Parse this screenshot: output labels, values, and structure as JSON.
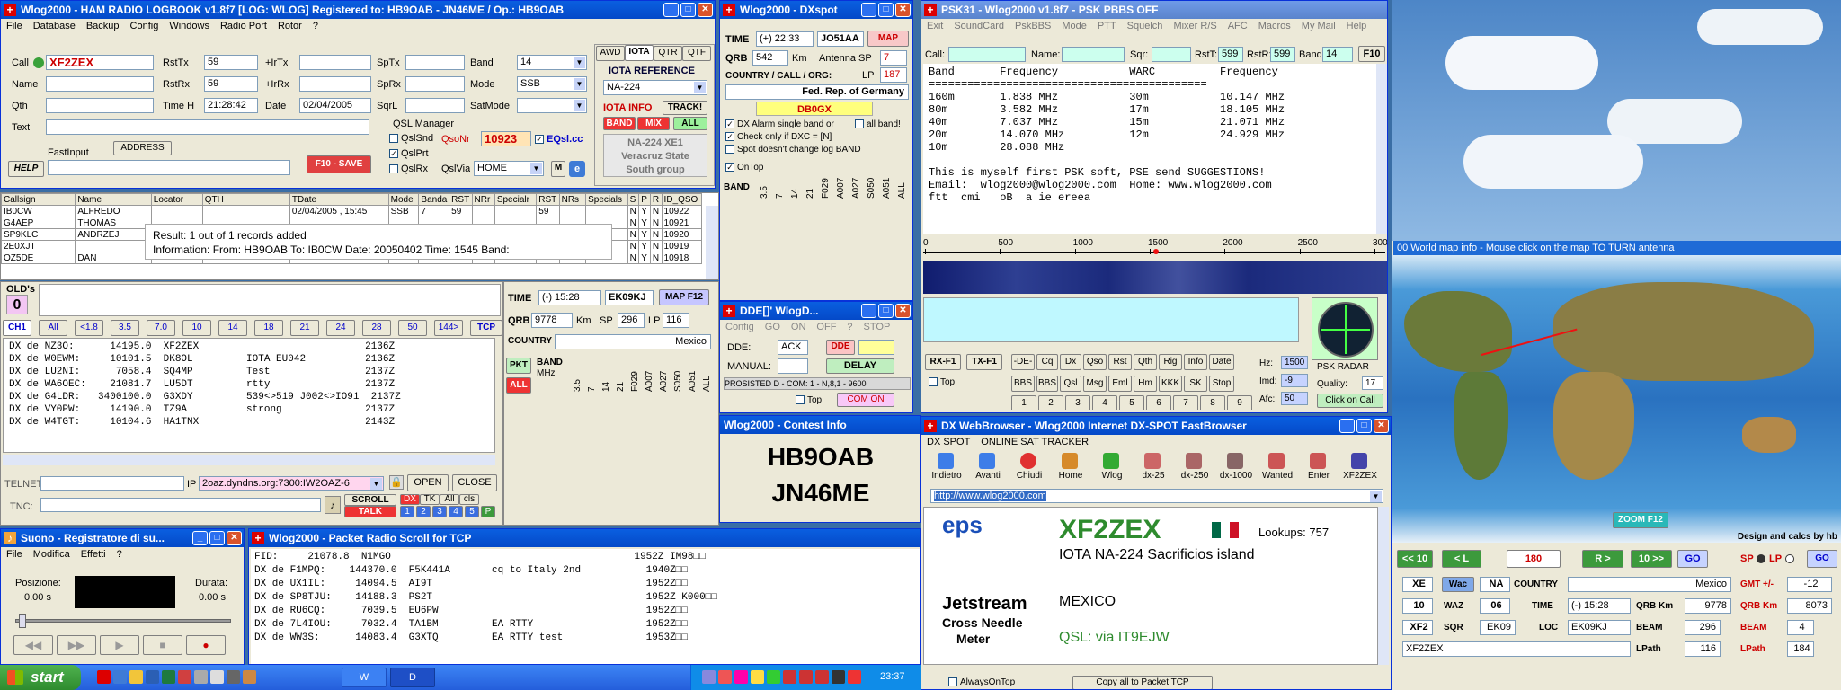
{
  "logbook": {
    "title": "Wlog2000 - HAM RADIO LOGBOOK v1.8f7      [LOG: WLOG]   Registered to: HB9OAB - JN46ME / Op.: HB9OAB",
    "menu": [
      "File",
      "Database",
      "Backup",
      "Config",
      "Windows",
      "Radio Port",
      "Rotor",
      "?"
    ],
    "labels": {
      "call": "Call",
      "name": "Name",
      "qth": "Qth",
      "text": "Text",
      "help": "HELP",
      "rsttx": "RstTx",
      "rstrx": "RstRx",
      "timeh": "Time H",
      "irtx": "+IrTx",
      "irrx": "+IrRx",
      "date": "Date",
      "sptx": "SpTx",
      "sprx": "SpRx",
      "sqrl": "SqrL",
      "band": "Band",
      "mode": "Mode",
      "satmode": "SatMode",
      "fastinput": "FastInput",
      "address": "ADDRESS",
      "qslmanager": "QSL Manager",
      "qslsnd": "QslSnd",
      "qslprt": "QslPrt",
      "qslrx": "QslRx",
      "qsonr": "QsoNr",
      "eqsl": "EQsl.cc",
      "qslvia": "QslVia",
      "save": "F10 - SAVE",
      "m": "M"
    },
    "values": {
      "call": "XF2ZEX",
      "rsttx": "59",
      "rstrx": "59",
      "timeh": "21:28:42",
      "date": "02/04/2005",
      "band": "14",
      "mode": "SSB",
      "qsonr": "10923",
      "qslvia": "HOME"
    },
    "tabs": [
      "AWD",
      "IOTA",
      "QTR",
      "QTF"
    ],
    "iota": {
      "reference_label": "IOTA REFERENCE",
      "ref": "NA-224",
      "info": "IOTA INFO",
      "track": "TRACK!",
      "band": "BAND",
      "mix": "MIX",
      "all": "ALL",
      "desc": [
        "NA-224 XE1",
        "Veracruz State",
        "South group"
      ]
    }
  },
  "qsogrid": {
    "headers": [
      "Callsign",
      "Name",
      "Locator",
      "QTH",
      "TDate",
      "Mode",
      "Banda",
      "RST",
      "NRr",
      "Specialr",
      "RST",
      "NRs",
      "Specials",
      "S",
      "P",
      "R",
      "ID_QSO"
    ],
    "rows": [
      [
        "IB0CW",
        "ALFREDO",
        "",
        "",
        "02/04/2005 , 15:45",
        "SSB",
        "7",
        "59",
        "",
        "",
        "59",
        "",
        "",
        "N",
        "Y",
        "N",
        "10922"
      ],
      [
        "G4AEP",
        "THOMAS",
        "",
        "",
        "",
        "",
        "",
        "",
        "",
        "",
        "",
        "",
        "",
        "N",
        "Y",
        "N",
        "10921"
      ],
      [
        "SP9KLC",
        "ANDRZEJ",
        "",
        "",
        "",
        "",
        "",
        "",
        "",
        "",
        "",
        "",
        "",
        "N",
        "Y",
        "N",
        "10920"
      ],
      [
        "2E0XJT",
        "",
        "",
        "",
        "",
        "",
        "",
        "",
        "",
        "",
        "",
        "",
        "",
        "N",
        "Y",
        "N",
        "10919"
      ],
      [
        "OZ5DE",
        "DAN",
        "",
        "",
        "",
        "",
        "",
        "",
        "",
        "",
        "",
        "",
        "",
        "N",
        "Y",
        "N",
        "10918"
      ]
    ],
    "popup": [
      "Result: 1 out of 1 records added",
      "Information: From: HB9OAB To: IB0CW Date: 20050402 Time: 1545 Band:"
    ]
  },
  "cluster": {
    "olds": "OLD's",
    "olds_count": "0",
    "bands": [
      "CH1",
      "All",
      "<1.8",
      "3.5",
      "7.0",
      "10",
      "14",
      "18",
      "21",
      "24",
      "28",
      "50",
      "144>",
      "TCP"
    ],
    "lines": [
      "DX de NZ3O:      14195.0  XF2ZEX                            2136Z",
      "DX de W0EWM:     10101.5  DK8OL         IOTA EU042          2136Z",
      "DX de LU2NI:      7058.4  SQ4MP         Test                2137Z",
      "DX de WA6OEC:    21081.7  LU5DT         rtty                2137Z",
      "DX de G4LDR:   3400100.0  G3XDY         539<>519 J002<>IO91  2137Z",
      "DX de VY0PW:     14190.0  TZ9A          strong              2137Z",
      "DX de W4TGT:     10104.6  HA1TNX                            2143Z"
    ],
    "telnet": "TELNET:",
    "ip_label": "IP",
    "ip": "2oaz.dyndns.org:7300:IW2OAZ-6",
    "open": "OPEN",
    "close": "CLOSE",
    "tnc": "TNC:",
    "scroll": "SCROLL",
    "talk": "TALK",
    "dx": "DX",
    "tk": "TK",
    "all": "All",
    "cls": "cls",
    "nums": [
      "1",
      "2",
      "3",
      "4",
      "5",
      "P"
    ]
  },
  "info2": {
    "time_label": "TIME",
    "time": "(-) 15:28",
    "loc": "EK09KJ",
    "map": "MAP F12",
    "qrb_label": "QRB",
    "qrb": "9778",
    "km": "Km",
    "sp_label": "SP",
    "sp": "296",
    "lp_label": "LP",
    "lp": "116",
    "country_label": "COUNTRY",
    "country": "Mexico",
    "pkt": "PKT",
    "all": "ALL",
    "band": "BAND",
    "mhz": "MHz",
    "cols": [
      "3.5",
      "7",
      "14",
      "21",
      "F029",
      "A007",
      "A027",
      "S050",
      "A051",
      "ALL"
    ],
    "rows": [
      [
        "DXC",
        "XE"
      ],
      [
        "WPX",
        "XF2"
      ],
      [
        "WAZ",
        "06"
      ],
      [
        "ITU",
        "10"
      ],
      [
        "WAC",
        "NA"
      ],
      [
        "SQR",
        ""
      ]
    ]
  },
  "dxspot": {
    "title": "Wlog2000 - DXspot",
    "time_label": "TIME",
    "time": "(+) 22:33",
    "loc": "JO51AA",
    "map": "MAP",
    "qrb_label": "QRB",
    "qrb": "542",
    "km": "Km",
    "antenna": "Antenna SP",
    "sp": "7",
    "country_label": "COUNTRY / CALL / ORG:",
    "lp_label": "LP",
    "lp": "187",
    "country": "Fed. Rep. of Germany",
    "call": "DB0GX",
    "opts": [
      "DX Alarm single band or",
      "all band!",
      "Check only if DXC = [N]",
      "Spot doesn't change log BAND",
      "OnTop"
    ],
    "band": "BAND",
    "cols": [
      "3.5",
      "7",
      "14",
      "21",
      "F029",
      "A007",
      "A027",
      "S050",
      "A051",
      "ALL"
    ],
    "rows": [
      [
        "DXC",
        "OL"
      ],
      [
        "WPX",
        "DB0"
      ],
      [
        "WAZ",
        "14"
      ],
      [
        "ITU",
        "28"
      ],
      [
        "WAC",
        "EU"
      ]
    ]
  },
  "dde": {
    "title": "DDE[]' WlogD...",
    "menu": [
      "Config",
      "GO",
      "ON",
      "OFF",
      "?",
      "STOP"
    ],
    "dde_label": "DDE:",
    "ack": "ACK",
    "dde": "DDE",
    "manual": "MANUAL:",
    "delay": "DELAY",
    "status": "PROSISTED D - COM: 1 - N,8,1 - 9600",
    "top": "Top",
    "com": "COM ON"
  },
  "contest": {
    "title": "Wlog2000 - Contest Info",
    "call": "HB9OAB",
    "loc": "JN46ME"
  },
  "psk": {
    "title": "PSK31 - Wlog2000 v1.8f7 - PSK PBBS OFF",
    "menu": [
      "Exit",
      "SoundCard",
      "PskBBS",
      "Mode",
      "PTT",
      "Squelch",
      "Mixer R/S",
      "AFC",
      "Macros",
      "My Mail",
      "Help"
    ],
    "fields": {
      "call": "Call:",
      "name": "Name:",
      "sqr": "Sqr:",
      "rstt": "RstT:",
      "rstt_v": "599",
      "rstr": "RstR:",
      "rstr_v": "599",
      "band": "Band:",
      "band_v": "14",
      "f10": "F10"
    },
    "text": [
      "Band       Frequency           WARC          Frequency",
      "===========================================",
      "160m       1.838 MHz           30m           10.147 MHz",
      "80m        3.582 MHz           17m           18.105 MHz",
      "40m        7.037 MHz           15m           21.071 MHz",
      "20m        14.070 MHz          12m           24.929 MHz",
      "10m        28.088 MHz",
      "",
      "This is myself first PSK soft, PSE send SUGGESTIONS!",
      "Email:  wlog2000@wlog2000.com  Home: www.wlog2000.com",
      "ftt  cmi   oB  a ie ereea"
    ],
    "scale": [
      "0",
      "500",
      "1000",
      "1500",
      "2000",
      "2500",
      "3000"
    ],
    "buttons": [
      "RX-F1",
      "TX-F1",
      "-DE-",
      "Cq",
      "Dx",
      "Qso",
      "Rst",
      "Qth",
      "Rig",
      "Info",
      "Date",
      "BBS",
      "BBS",
      "Qsl",
      "Msg",
      "Eml",
      "Hm",
      "KKK",
      "SK",
      "Stop",
      "1",
      "2",
      "3",
      "4",
      "5",
      "6",
      "7",
      "8",
      "9"
    ],
    "top": "Top",
    "hz": "Hz:",
    "hz_v": "1500",
    "imd": "Imd:",
    "imd_v": "-9",
    "afc": "Afc:",
    "afc_v": "50",
    "radar": "PSK RADAR",
    "quality": "Quality:",
    "quality_v": "17",
    "click": "Click on Call"
  },
  "web": {
    "title": "DX WebBrowser - Wlog2000 Internet DX-SPOT FastBrowser",
    "menu": [
      "DX SPOT",
      "ONLINE SAT TRACKER"
    ],
    "tools": [
      "Indietro",
      "Avanti",
      "Chiudi",
      "Home",
      "Wlog",
      "dx-25",
      "dx-250",
      "dx-1000",
      "Wanted",
      "Enter",
      "XF2ZEX"
    ],
    "url": "http://www.wlog2000.com",
    "logo": "eps",
    "call": "XF2ZEX",
    "lookups": "Lookups: 757",
    "iota": "IOTA NA-224 Sacrificios island",
    "country": "MEXICO",
    "qsl": "QSL:  via IT9EJW",
    "ad1": "Jetstream",
    "ad2": "Cross Needle",
    "ad3": "Meter",
    "ontop": "AlwaysOnTop",
    "copy": "Copy all to Packet TCP"
  },
  "worldmap": {
    "title": "00 World map info - Mouse click on the map TO TURN antenna",
    "zoom": "ZOOM F12",
    "design": "Design and calcs by hb",
    "nav": [
      "<< 10",
      "< L",
      "180",
      "R >",
      "10 >>",
      "GO"
    ],
    "sp": "SP",
    "lp": "LP",
    "go": "GO",
    "row1": [
      "XE",
      "Wac",
      "NA",
      "COUNTRY",
      "Mexico",
      "GMT +/-",
      "-12"
    ],
    "f11": "F11",
    "row2": [
      "10",
      "WAZ",
      "06",
      "TIME",
      "(-) 15:28",
      "QRB Km",
      "9778",
      "QRB Km",
      "8073"
    ],
    "row3": [
      "XF2",
      "SQR",
      "EK09",
      "LOC",
      "EK09KJ",
      "BEAM",
      "296",
      "BEAM",
      "4"
    ],
    "row4": [
      "XF2ZEX",
      "LPath",
      "116",
      "LPath",
      "184"
    ]
  },
  "sound": {
    "title": "Suono - Registratore di su...",
    "menu": [
      "File",
      "Modifica",
      "Effetti",
      "?"
    ],
    "pos": "Posizione:",
    "pos_v": "0.00 s",
    "dur": "Durata:",
    "dur_v": "0.00 s"
  },
  "packet": {
    "title": "Wlog2000 - Packet Radio Scroll for TCP",
    "lines": [
      "FID:     21078.8  N1MGO                                         1952Z IM98□□",
      "DX de F1MPQ:    144370.0  F5K441A       cq to Italy 2nd           1940Z□□",
      "DX de UX1IL:     14094.5  AI9T                                    1952Z□□",
      "DX de SP8TJU:    14188.3  PS2T                                    1952Z K000□□",
      "DX de RU6CQ:      7039.5  EU6PW                                   1952Z□□",
      "DX de 7L4IOU:     7032.4  TA1BM         EA RTTY                   1952Z□□",
      "DX de WW3S:      14083.4  G3XTQ         EA RTTY test              1953Z□□"
    ]
  },
  "taskbar": {
    "start": "start",
    "clock": "23:37",
    "tasks": [
      "W",
      "D"
    ]
  },
  "colors": {
    "title": "#0a5fe0",
    "face": "#ece9d8",
    "red": "#d00000",
    "green": "#3c9a3c"
  }
}
